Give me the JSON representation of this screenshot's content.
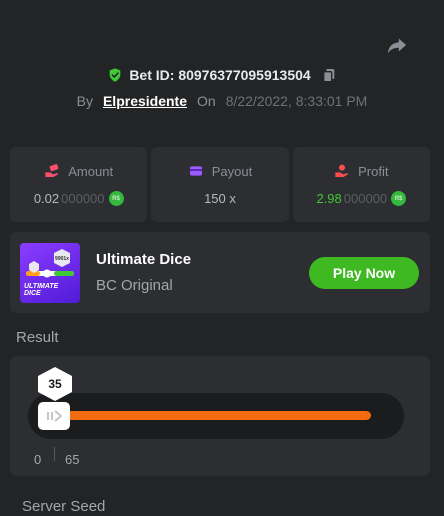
{
  "header": {
    "share_icon": "share-icon",
    "bet_label": "Bet ID: 8097637709591350",
    "bet_suffix": "4",
    "verified_icon": "shield-check-icon",
    "copy_icon": "copy-icon"
  },
  "meta": {
    "by_label": "By",
    "user": "Elpresidente",
    "on_label": "On",
    "datetime": "8/22/2022, 8:33:01 PM"
  },
  "stats": [
    {
      "label": "Amount",
      "icon": "money-hand-icon",
      "value_main": "0.02",
      "value_zeros": "000000",
      "currency": "R$"
    },
    {
      "label": "Payout",
      "icon": "wallet-icon",
      "value": "150 x"
    },
    {
      "label": "Profit",
      "icon": "coin-hand-icon",
      "value_main": "2.98",
      "value_zeros": "000000",
      "currency": "R$"
    }
  ],
  "game": {
    "title": "Ultimate Dice",
    "subtitle": "BC Original",
    "play_label": "Play Now",
    "thumb_text": [
      "ULTIMATE",
      "DICE"
    ],
    "thumb_badge": "9901x"
  },
  "result": {
    "label": "Result",
    "value": "35",
    "range_start": "0",
    "range_mark": "65",
    "fill_fraction": 0.94
  },
  "server_seed": {
    "label": "Server Seed"
  },
  "colors": {
    "background": "#232426",
    "card": "#2d2e32",
    "accent_green": "#3fb922",
    "profit_green": "#3fc935",
    "bar_orange": "#f26b0f",
    "game_purple": "#8c3dff"
  }
}
